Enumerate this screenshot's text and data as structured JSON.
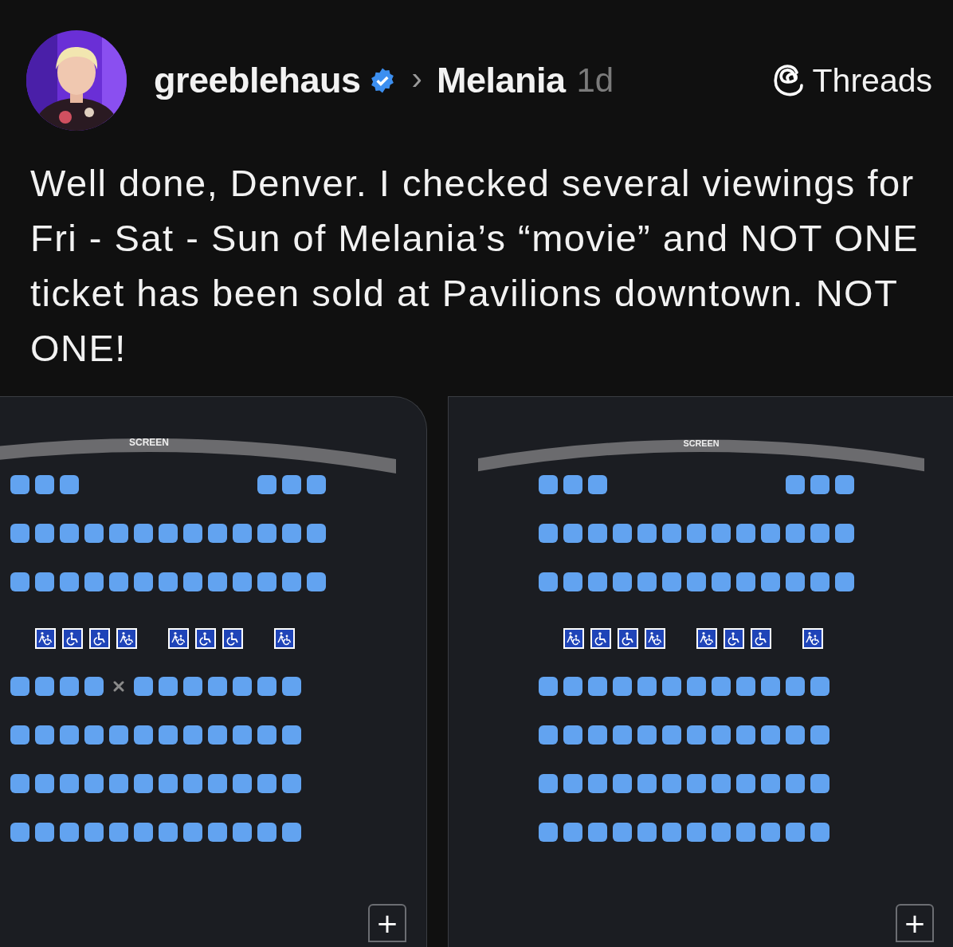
{
  "post": {
    "author": {
      "username": "greeblehaus",
      "verified": true
    },
    "separator": "›",
    "topic": "Melania",
    "time": "1d",
    "app_label": "Threads",
    "text": "Well done, Denver. I checked several viewings for Fri - Sat - Sun of Melania’s “movie” and NOT ONE ticket has been sold at Pavilions downtown. NOT ONE!"
  },
  "seat_maps": [
    {
      "screen_label": "SCREEN",
      "zoom_in": "+",
      "rows": [
        {
          "seats": [
            {
              "kind": "seat"
            },
            {
              "kind": "seat"
            },
            {
              "kind": "seat"
            },
            {
              "kind": "gap"
            },
            {
              "kind": "gap"
            },
            {
              "kind": "gap"
            },
            {
              "kind": "gap"
            },
            {
              "kind": "gap"
            },
            {
              "kind": "gap"
            },
            {
              "kind": "gap"
            },
            {
              "kind": "seat"
            },
            {
              "kind": "seat"
            },
            {
              "kind": "seat"
            }
          ]
        },
        {
          "seats": [
            {
              "kind": "seat"
            },
            {
              "kind": "seat"
            },
            {
              "kind": "seat"
            },
            {
              "kind": "seat"
            },
            {
              "kind": "seat"
            },
            {
              "kind": "seat"
            },
            {
              "kind": "seat"
            },
            {
              "kind": "seat"
            },
            {
              "kind": "seat"
            },
            {
              "kind": "seat"
            },
            {
              "kind": "seat"
            },
            {
              "kind": "seat"
            },
            {
              "kind": "seat"
            }
          ]
        },
        {
          "seats": [
            {
              "kind": "seat"
            },
            {
              "kind": "seat"
            },
            {
              "kind": "seat"
            },
            {
              "kind": "seat"
            },
            {
              "kind": "seat"
            },
            {
              "kind": "seat"
            },
            {
              "kind": "seat"
            },
            {
              "kind": "seat"
            },
            {
              "kind": "seat"
            },
            {
              "kind": "seat"
            },
            {
              "kind": "seat"
            },
            {
              "kind": "seat"
            },
            {
              "kind": "seat"
            }
          ]
        },
        {
          "seats": [
            {
              "kind": "gap"
            },
            {
              "kind": "companion"
            },
            {
              "kind": "wheelchair"
            },
            {
              "kind": "wheelchair"
            },
            {
              "kind": "companion"
            },
            {
              "kind": "gap"
            },
            {
              "kind": "companion"
            },
            {
              "kind": "wheelchair"
            },
            {
              "kind": "wheelchair"
            },
            {
              "kind": "gap"
            },
            {
              "kind": "companion"
            }
          ]
        },
        {
          "seats": [
            {
              "kind": "seat"
            },
            {
              "kind": "seat"
            },
            {
              "kind": "seat"
            },
            {
              "kind": "seat"
            },
            {
              "kind": "blocked"
            },
            {
              "kind": "seat"
            },
            {
              "kind": "seat"
            },
            {
              "kind": "seat"
            },
            {
              "kind": "seat"
            },
            {
              "kind": "seat"
            },
            {
              "kind": "seat"
            },
            {
              "kind": "seat"
            }
          ]
        },
        {
          "seats": [
            {
              "kind": "seat"
            },
            {
              "kind": "seat"
            },
            {
              "kind": "seat"
            },
            {
              "kind": "seat"
            },
            {
              "kind": "seat"
            },
            {
              "kind": "seat"
            },
            {
              "kind": "seat"
            },
            {
              "kind": "seat"
            },
            {
              "kind": "seat"
            },
            {
              "kind": "seat"
            },
            {
              "kind": "seat"
            },
            {
              "kind": "seat"
            }
          ]
        },
        {
          "seats": [
            {
              "kind": "seat"
            },
            {
              "kind": "seat"
            },
            {
              "kind": "seat"
            },
            {
              "kind": "seat"
            },
            {
              "kind": "seat"
            },
            {
              "kind": "seat"
            },
            {
              "kind": "seat"
            },
            {
              "kind": "seat"
            },
            {
              "kind": "seat"
            },
            {
              "kind": "seat"
            },
            {
              "kind": "seat"
            },
            {
              "kind": "seat"
            }
          ]
        },
        {
          "seats": [
            {
              "kind": "seat"
            },
            {
              "kind": "seat"
            },
            {
              "kind": "seat"
            },
            {
              "kind": "seat"
            },
            {
              "kind": "seat"
            },
            {
              "kind": "seat"
            },
            {
              "kind": "seat"
            },
            {
              "kind": "seat"
            },
            {
              "kind": "seat"
            },
            {
              "kind": "seat"
            },
            {
              "kind": "seat"
            },
            {
              "kind": "seat"
            }
          ]
        }
      ]
    },
    {
      "screen_label": "SCREEN",
      "zoom_in": "+",
      "rows": [
        {
          "seats": [
            {
              "kind": "seat"
            },
            {
              "kind": "seat"
            },
            {
              "kind": "seat"
            },
            {
              "kind": "gap"
            },
            {
              "kind": "gap"
            },
            {
              "kind": "gap"
            },
            {
              "kind": "gap"
            },
            {
              "kind": "gap"
            },
            {
              "kind": "gap"
            },
            {
              "kind": "gap"
            },
            {
              "kind": "seat"
            },
            {
              "kind": "seat"
            },
            {
              "kind": "seat"
            }
          ]
        },
        {
          "seats": [
            {
              "kind": "seat"
            },
            {
              "kind": "seat"
            },
            {
              "kind": "seat"
            },
            {
              "kind": "seat"
            },
            {
              "kind": "seat"
            },
            {
              "kind": "seat"
            },
            {
              "kind": "seat"
            },
            {
              "kind": "seat"
            },
            {
              "kind": "seat"
            },
            {
              "kind": "seat"
            },
            {
              "kind": "seat"
            },
            {
              "kind": "seat"
            },
            {
              "kind": "seat"
            }
          ]
        },
        {
          "seats": [
            {
              "kind": "seat"
            },
            {
              "kind": "seat"
            },
            {
              "kind": "seat"
            },
            {
              "kind": "seat"
            },
            {
              "kind": "seat"
            },
            {
              "kind": "seat"
            },
            {
              "kind": "seat"
            },
            {
              "kind": "seat"
            },
            {
              "kind": "seat"
            },
            {
              "kind": "seat"
            },
            {
              "kind": "seat"
            },
            {
              "kind": "seat"
            },
            {
              "kind": "seat"
            }
          ]
        },
        {
          "seats": [
            {
              "kind": "gap"
            },
            {
              "kind": "companion"
            },
            {
              "kind": "wheelchair"
            },
            {
              "kind": "wheelchair"
            },
            {
              "kind": "companion"
            },
            {
              "kind": "gap"
            },
            {
              "kind": "companion"
            },
            {
              "kind": "wheelchair"
            },
            {
              "kind": "wheelchair"
            },
            {
              "kind": "gap"
            },
            {
              "kind": "companion"
            }
          ]
        },
        {
          "seats": [
            {
              "kind": "seat"
            },
            {
              "kind": "seat"
            },
            {
              "kind": "seat"
            },
            {
              "kind": "seat"
            },
            {
              "kind": "seat"
            },
            {
              "kind": "seat"
            },
            {
              "kind": "seat"
            },
            {
              "kind": "seat"
            },
            {
              "kind": "seat"
            },
            {
              "kind": "seat"
            },
            {
              "kind": "seat"
            },
            {
              "kind": "seat"
            }
          ]
        },
        {
          "seats": [
            {
              "kind": "seat"
            },
            {
              "kind": "seat"
            },
            {
              "kind": "seat"
            },
            {
              "kind": "seat"
            },
            {
              "kind": "seat"
            },
            {
              "kind": "seat"
            },
            {
              "kind": "seat"
            },
            {
              "kind": "seat"
            },
            {
              "kind": "seat"
            },
            {
              "kind": "seat"
            },
            {
              "kind": "seat"
            },
            {
              "kind": "seat"
            }
          ]
        },
        {
          "seats": [
            {
              "kind": "seat"
            },
            {
              "kind": "seat"
            },
            {
              "kind": "seat"
            },
            {
              "kind": "seat"
            },
            {
              "kind": "seat"
            },
            {
              "kind": "seat"
            },
            {
              "kind": "seat"
            },
            {
              "kind": "seat"
            },
            {
              "kind": "seat"
            },
            {
              "kind": "seat"
            },
            {
              "kind": "seat"
            },
            {
              "kind": "seat"
            }
          ]
        },
        {
          "seats": [
            {
              "kind": "seat"
            },
            {
              "kind": "seat"
            },
            {
              "kind": "seat"
            },
            {
              "kind": "seat"
            },
            {
              "kind": "seat"
            },
            {
              "kind": "seat"
            },
            {
              "kind": "seat"
            },
            {
              "kind": "seat"
            },
            {
              "kind": "seat"
            },
            {
              "kind": "seat"
            },
            {
              "kind": "seat"
            },
            {
              "kind": "seat"
            }
          ]
        }
      ]
    }
  ]
}
